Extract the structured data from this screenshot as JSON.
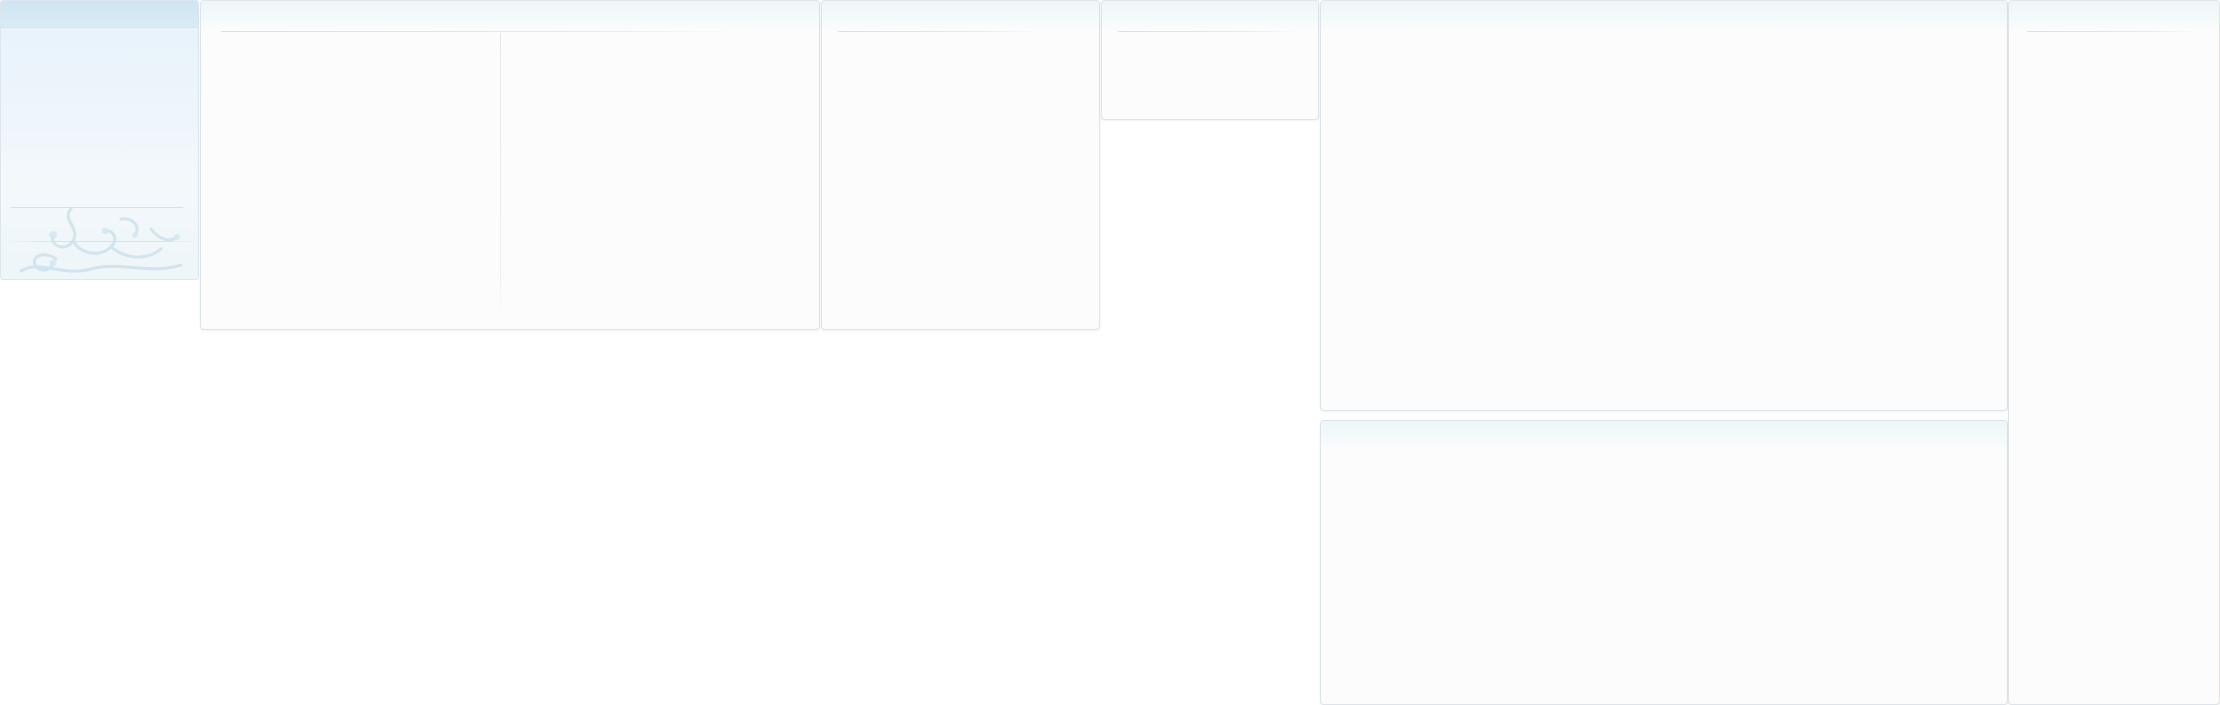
{
  "layout": {
    "panels": [
      {
        "id": "sidebar-widget"
      },
      {
        "id": "panel-a"
      },
      {
        "id": "panel-b"
      },
      {
        "id": "panel-c"
      },
      {
        "id": "panel-d"
      },
      {
        "id": "panel-e"
      },
      {
        "id": "panel-f"
      }
    ]
  },
  "theme": {
    "border_color": "#dde4ea",
    "header_tint": "#eef6f8",
    "sidebar_tint": "#e7f2fb",
    "rule_color": "#cfe4ec"
  },
  "decorations": {
    "sidebar_ornament": "swirl-ornament"
  }
}
